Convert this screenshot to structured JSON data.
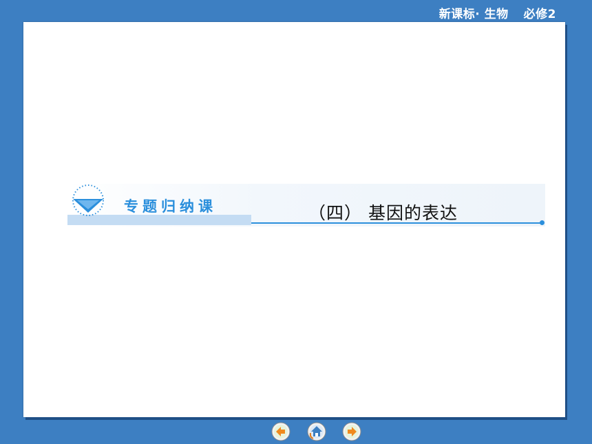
{
  "header": {
    "series": "新课标· 生物",
    "volume": "必修2"
  },
  "slide": {
    "section_label": "专题归纳课",
    "topic_title": "（四） 基因的表达"
  },
  "nav": {
    "prev_icon": "back-arrow-icon",
    "home_icon": "home-icon",
    "next_icon": "forward-arrow-icon"
  },
  "colors": {
    "background": "#3d7fc2",
    "accent": "#2b8fdc",
    "label_band": "#c4dcf3"
  }
}
